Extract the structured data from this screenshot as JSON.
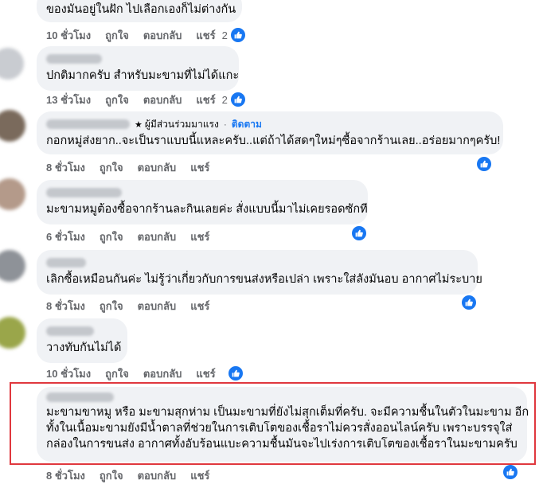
{
  "comments": [
    {
      "text_lines": [
        "ของมันอยู่ในฝัก ไปเลือกเองก็ไม่ต่างกัน"
      ],
      "time": "10 ชั่วโมง",
      "like": "ถูกใจ",
      "reply": "ตอบกลับ",
      "share": "แชร์",
      "reaction_count": "2"
    },
    {
      "text_lines": [
        "ปกติมากครับ สำหรับมะขามที่ไม่ได้แกะ"
      ],
      "time": "13 ชั่วโมง",
      "like": "ถูกใจ",
      "reply": "ตอบกลับ",
      "share": "แชร์",
      "reaction_count": "2"
    },
    {
      "badge": "ผู้มีส่วนร่วมมาแรง",
      "follow": "ติดตาม",
      "separator": "·",
      "text_lines": [
        "กอกหมู่ส่งยาก..จะเป็นราแบบนี้แหละครับ..แต่ถ้าได้สดๆใหม่ๆซื้อจากร้านเลย..อร่อยมากๆครับ!"
      ],
      "time": "8 ชั่วโมง",
      "like": "ถูกใจ",
      "reply": "ตอบกลับ",
      "share": "แชร์"
    },
    {
      "text_lines": [
        "มะขามหมูต้องซื้อจากร้านละกินเลยค่ะ สั่งแบบนี้มาไม่เคยรอดซักที"
      ],
      "time": "6 ชั่วโมง",
      "like": "ถูกใจ",
      "reply": "ตอบกลับ",
      "share": "แชร์"
    },
    {
      "text_lines": [
        "เลิกซื้อเหมือนกันค่ะ ไม่รู้ว่าเกี่ยวกับการขนส่งหรือเปล่า เพราะใส่ลังมันอบ อากาศไม่ระบาย"
      ],
      "time": "8 ชั่วโมง",
      "like": "ถูกใจ",
      "reply": "ตอบกลับ",
      "share": "แชร์"
    },
    {
      "text_lines": [
        "วางทับกันไม่ได้"
      ],
      "time": "10 ชั่วโมง",
      "like": "ถูกใจ",
      "reply": "ตอบกลับ",
      "share": "แชร์"
    },
    {
      "text_lines": [
        "มะขามขาหมู หรือ มะขามสุกห่าม เป็นมะขามที่ยังไม่สุกเต็มที่ครับ. จะมีความชื้นในตัวในมะขาม อีก",
        "ทั้งในเนื้อมะขามยังมีน้ำตาลที่ช่วยในการเติบโตของเชื้อราไม่ควรสั่งออนไลน์ครับ เพราะบรรจุใส่",
        "กล่องในการขนส่ง อากาศทั้งอับร้อนแบะความชื้นมันจะไปเร่งการเติบโตของเชื้อราในมะขามครับ"
      ],
      "time": "8 ชั่วโมง",
      "like": "ถูกใจ",
      "reply": "ตอบกลับ",
      "share": "แชร์"
    }
  ],
  "colors": {
    "bubble": "#f0f2f5",
    "link": "#1877f2",
    "meta": "#65676b",
    "highlight": "#e0383e"
  }
}
